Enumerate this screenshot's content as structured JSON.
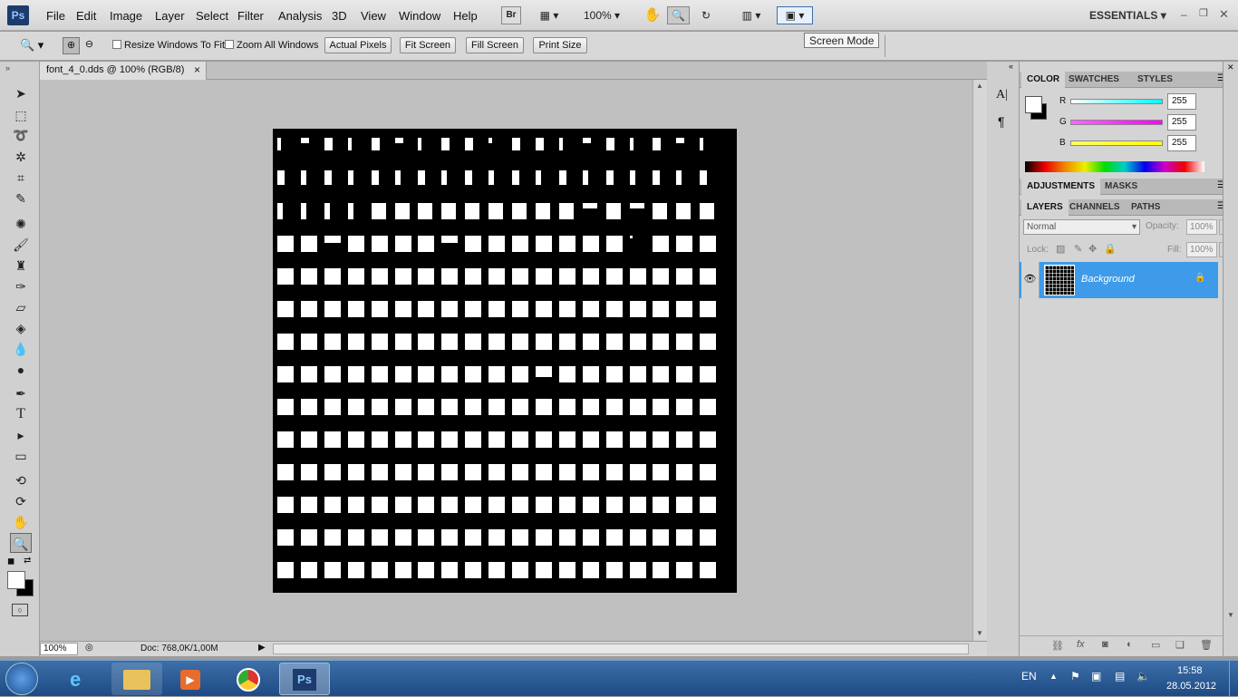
{
  "app": {
    "logo": "Ps"
  },
  "menus": [
    "File",
    "Edit",
    "Image",
    "Layer",
    "Select",
    "Filter",
    "Analysis",
    "3D",
    "View",
    "Window",
    "Help"
  ],
  "menubar": {
    "bridge": "Br",
    "zoom": "100%",
    "workspace": "ESSENTIALS"
  },
  "options": {
    "resize_windows": "Resize Windows To Fit",
    "zoom_all": "Zoom All Windows",
    "actual_pixels": "Actual Pixels",
    "fit_screen": "Fit Screen",
    "fill_screen": "Fill Screen",
    "print_size": "Print Size"
  },
  "tooltip": "Screen Mode",
  "document": {
    "tab_title": "font_4_0.dds @ 100% (RGB/8)",
    "close": "×"
  },
  "status": {
    "zoom": "100%",
    "doc": "Doc: 768,0K/1,00M"
  },
  "color_panel": {
    "tabs": [
      "COLOR",
      "SWATCHES",
      "STYLES"
    ],
    "channels": [
      {
        "label": "R",
        "value": "255",
        "color": "#00e5e5"
      },
      {
        "label": "G",
        "value": "255",
        "color": "#e500e5"
      },
      {
        "label": "B",
        "value": "255",
        "color": "#e5e500"
      }
    ]
  },
  "adjust_panel": {
    "tabs": [
      "ADJUSTMENTS",
      "MASKS"
    ]
  },
  "layers_panel": {
    "tabs": [
      "LAYERS",
      "CHANNELS",
      "PATHS"
    ],
    "blend_mode": "Normal",
    "opacity_label": "Opacity:",
    "opacity": "100%",
    "lock_label": "Lock:",
    "fill_label": "Fill:",
    "fill": "100%",
    "layers": [
      {
        "name": "Background",
        "selected": true
      }
    ]
  },
  "taskbar": {
    "lang": "EN",
    "time": "15:58",
    "date": "28.05.2012"
  },
  "colors": {
    "selection": "#3d9be9",
    "taskbar": "#1d4a84"
  }
}
